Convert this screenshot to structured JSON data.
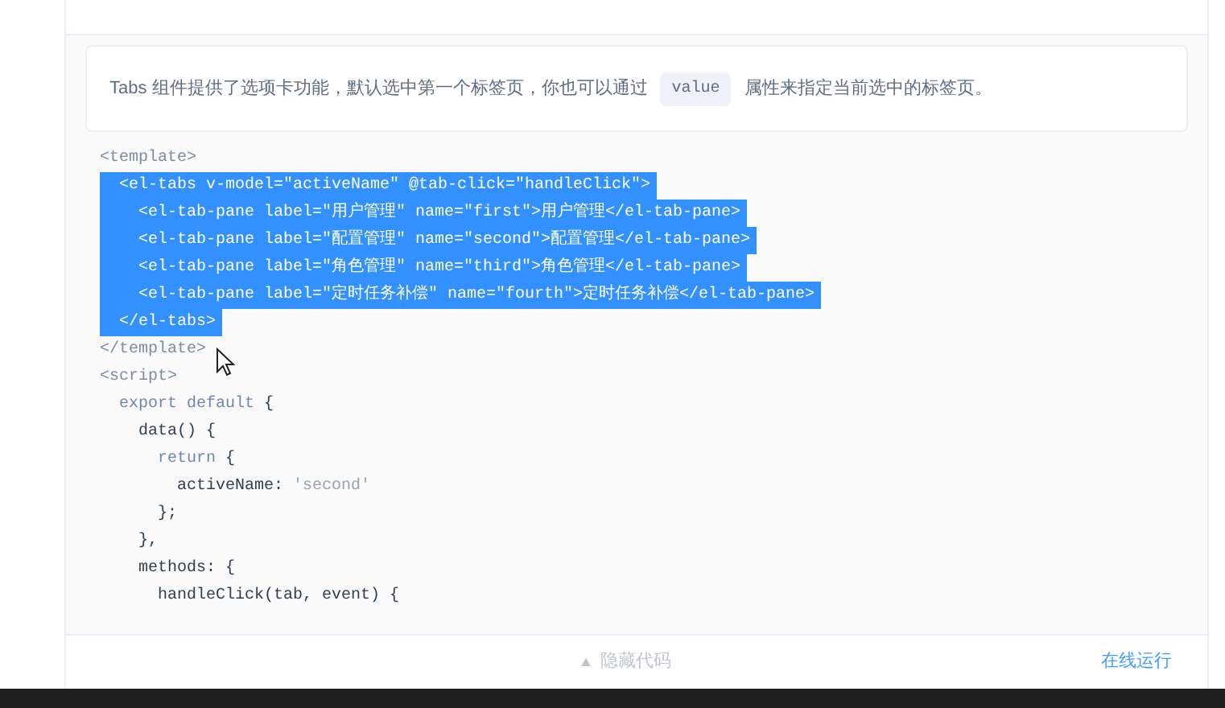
{
  "description": {
    "before": "Tabs 组件提供了选项卡功能，默认选中第一个标签页，你也可以通过",
    "code": "value",
    "after": "属性来指定当前选中的标签页。"
  },
  "code_lines": [
    {
      "selected": false,
      "segments": [
        {
          "kind": "tag",
          "text": "<template>"
        }
      ]
    },
    {
      "selected": true,
      "segments": [
        {
          "kind": "plain",
          "text": "  <el-tabs v-model=\"activeName\" @tab-click=\"handleClick\">"
        }
      ]
    },
    {
      "selected": true,
      "segments": [
        {
          "kind": "plain",
          "text": "    <el-tab-pane label=\"用户管理\" name=\"first\">用户管理</el-tab-pane>"
        }
      ]
    },
    {
      "selected": true,
      "segments": [
        {
          "kind": "plain",
          "text": "    <el-tab-pane label=\"配置管理\" name=\"second\">配置管理</el-tab-pane>"
        }
      ]
    },
    {
      "selected": true,
      "segments": [
        {
          "kind": "plain",
          "text": "    <el-tab-pane label=\"角色管理\" name=\"third\">角色管理</el-tab-pane>"
        }
      ]
    },
    {
      "selected": true,
      "segments": [
        {
          "kind": "plain",
          "text": "    <el-tab-pane label=\"定时任务补偿\" name=\"fourth\">定时任务补偿</el-tab-pane>"
        }
      ]
    },
    {
      "selected": true,
      "segments": [
        {
          "kind": "plain",
          "text": "  </el-tabs>"
        }
      ]
    },
    {
      "selected": false,
      "segments": [
        {
          "kind": "tag",
          "text": "</template>"
        }
      ]
    },
    {
      "selected": false,
      "segments": [
        {
          "kind": "tag",
          "text": "<script>"
        }
      ]
    },
    {
      "selected": false,
      "segments": [
        {
          "kind": "keyword",
          "text": "  export default"
        },
        {
          "kind": "plain",
          "text": " {"
        }
      ]
    },
    {
      "selected": false,
      "segments": [
        {
          "kind": "plain",
          "text": "    data() {"
        }
      ]
    },
    {
      "selected": false,
      "segments": [
        {
          "kind": "keyword",
          "text": "      return"
        },
        {
          "kind": "plain",
          "text": " {"
        }
      ]
    },
    {
      "selected": false,
      "segments": [
        {
          "kind": "plain",
          "text": "        activeName: "
        },
        {
          "kind": "string",
          "text": "'second'"
        }
      ]
    },
    {
      "selected": false,
      "segments": [
        {
          "kind": "plain",
          "text": "      };"
        }
      ]
    },
    {
      "selected": false,
      "segments": [
        {
          "kind": "plain",
          "text": "    },"
        }
      ]
    },
    {
      "selected": false,
      "segments": [
        {
          "kind": "plain",
          "text": "    methods: {"
        }
      ]
    },
    {
      "selected": false,
      "segments": [
        {
          "kind": "plain",
          "text": "      handleClick(tab, event) {"
        }
      ]
    }
  ],
  "footer": {
    "hide_code": "隐藏代码",
    "run_online": "在线运行"
  }
}
